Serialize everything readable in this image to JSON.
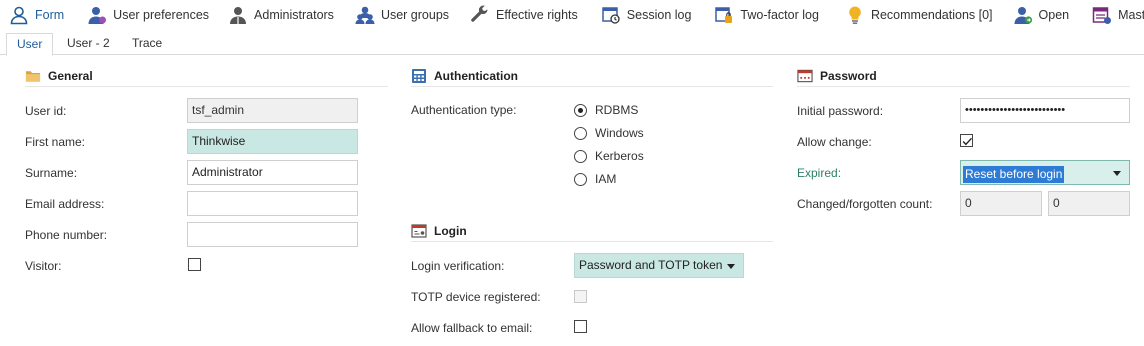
{
  "toolbar": {
    "items": [
      {
        "label": "Form",
        "icon": "user-form-icon",
        "active": true
      },
      {
        "label": "User preferences",
        "icon": "user-preferences-icon"
      },
      {
        "label": "Administrators",
        "icon": "administrator-icon"
      },
      {
        "label": "User groups",
        "icon": "user-groups-icon"
      },
      {
        "label": "Effective rights",
        "icon": "wrench-icon"
      },
      {
        "label": "Session log",
        "icon": "session-log-icon"
      },
      {
        "label": "Two-factor log",
        "icon": "two-factor-log-icon"
      },
      {
        "label": "Recommendations [0]",
        "icon": "lightbulb-icon"
      },
      {
        "label": "Open",
        "icon": "open-user-icon"
      },
      {
        "label": "Master data",
        "icon": "master-data-icon"
      }
    ]
  },
  "tabs": [
    {
      "label": "User",
      "active": true
    },
    {
      "label": "User - 2"
    },
    {
      "label": "Trace"
    }
  ],
  "general": {
    "title": "General",
    "user_id_label": "User id:",
    "user_id_value": "tsf_admin",
    "first_name_label": "First name:",
    "first_name_value": "Thinkwise",
    "surname_label": "Surname:",
    "surname_value": "Administrator",
    "email_label": "Email address:",
    "email_value": "",
    "phone_label": "Phone number:",
    "phone_value": "",
    "visitor_label": "Visitor:",
    "visitor_checked": false
  },
  "authentication": {
    "title": "Authentication",
    "type_label": "Authentication type:",
    "options": [
      "RDBMS",
      "Windows",
      "Kerberos",
      "IAM"
    ],
    "selected": "RDBMS"
  },
  "login": {
    "title": "Login",
    "verification_label": "Login verification:",
    "verification_value": "Password and TOTP token",
    "totp_label": "TOTP device registered:",
    "totp_checked": false,
    "fallback_label": "Allow fallback to email:",
    "fallback_checked": false
  },
  "password": {
    "title": "Password",
    "initial_label": "Initial password:",
    "initial_value": "••••••••••••••••••••••••••",
    "allow_change_label": "Allow change:",
    "allow_change_checked": true,
    "expired_label": "Expired:",
    "expired_value": "Reset before login",
    "changed_label": "Changed/forgotten count:",
    "changed_value": "0",
    "forgotten_value": "0"
  },
  "colors": {
    "accent": "#1f5c99",
    "highlight": "#c9e7e3",
    "selection": "#2e7bd6",
    "expired_label": "#2f7d68"
  }
}
